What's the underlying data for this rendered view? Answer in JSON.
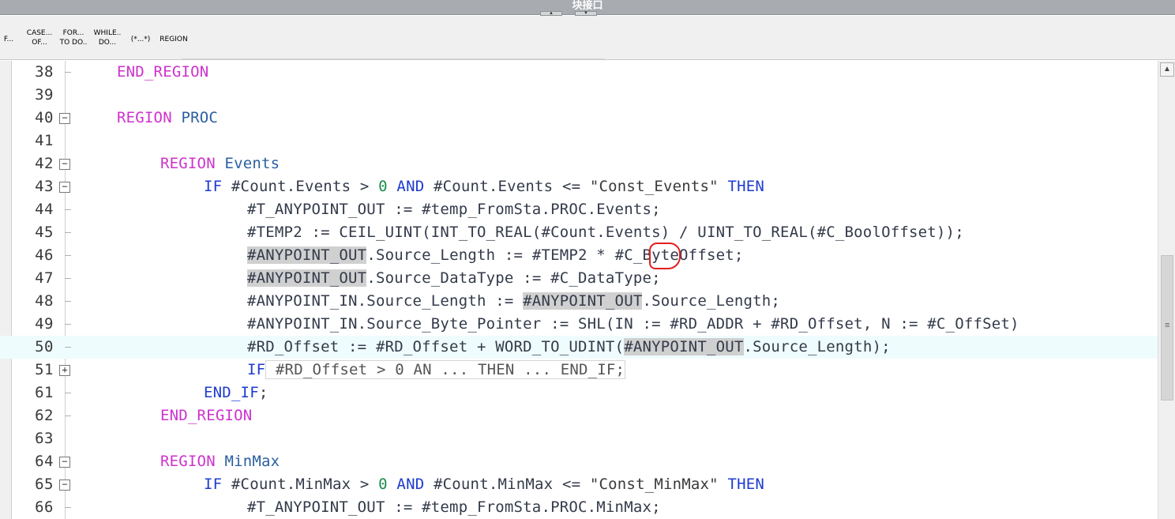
{
  "window": {
    "title": "块接口"
  },
  "toolbar": {
    "buttons": [
      {
        "line1": "F...",
        "line2": ""
      },
      {
        "line1": "CASE...",
        "line2": "OF..."
      },
      {
        "line1": "FOR...",
        "line2": "TO DO.."
      },
      {
        "line1": "WHILE..",
        "line2": "DO..."
      },
      {
        "line1": "(*...*)",
        "line2": ""
      },
      {
        "line1": "REGION",
        "line2": ""
      }
    ]
  },
  "editor": {
    "line_numbers": [
      "38",
      "39",
      "40",
      "41",
      "42",
      "43",
      "44",
      "45",
      "46",
      "47",
      "48",
      "49",
      "50",
      "51",
      "61",
      "62",
      "63",
      "64",
      "65",
      "66"
    ],
    "lines": {
      "l38": {
        "kw": "END_REGION"
      },
      "l40": {
        "kw": "REGION",
        "name": " PROC"
      },
      "l42": {
        "kw": "REGION",
        "name": " Events"
      },
      "l43": {
        "a": "IF",
        "b": " #Count.Events > ",
        "c": "0",
        "d": " AND",
        "e": " #Count.Events <= ",
        "f": "\"Const_Events\"",
        "g": " THEN"
      },
      "l44": {
        "a": "#T_ANYPOINT_OUT := #temp_FromSta.PROC.Events;"
      },
      "l45": {
        "a": "#TEMP2 := CEIL_UINT(INT_TO_REAL(#Count.Events) / UINT_TO_REAL(#C_BoolOffset));"
      },
      "l46": {
        "hl": "#ANYPOINT_OUT",
        "a": ".Source_Length := #TEMP2 * #C_ByteOffset;"
      },
      "l47": {
        "hl": "#ANYPOINT_OUT",
        "a": ".Source_DataType := #C_DataType;"
      },
      "l48": {
        "a": "#ANYPOINT_IN.Source_Length := ",
        "hl": "#ANYPOINT_OUT",
        "b": ".Source_Length;"
      },
      "l49": {
        "a": "#ANYPOINT_IN.Source_Byte_Pointer := SHL(IN := #RD_ADDR + #RD_Offset, N := #C_OffSet)"
      },
      "l50": {
        "a": "#RD_Offset := #RD_Offset + WORD_TO_UDINT(",
        "hl": "#ANYPOINT_OUT",
        "b": ".Source_Length);"
      },
      "l51": {
        "a": "IF",
        "b": " #RD_Offset > 0 AN ... THEN ... END_IF;"
      },
      "l61": {
        "kw": "END_IF",
        "a": ";"
      },
      "l62": {
        "kw": "END_REGION"
      },
      "l64": {
        "kw": "REGION",
        "name": " MinMax"
      },
      "l65": {
        "a": "IF",
        "b": " #Count.MinMax > ",
        "c": "0",
        "d": " AND",
        "e": " #Count.MinMax <= ",
        "f": "\"Const_MinMax\"",
        "g": " THEN"
      },
      "l66": {
        "a": "#T_ANYPOINT_OUT := #temp_FromSta.PROC.MinMax;"
      }
    }
  },
  "colors": {
    "keyword": "#1d3bd0",
    "region": "#cc33cc",
    "region_name": "#2b5fa0",
    "number": "#1a8c4a",
    "highlight": "#d0d0d0",
    "current_line": "#eefcfd",
    "annotation": "#e02020"
  },
  "icons": {
    "fold_open": "minus-box-icon",
    "fold_closed": "plus-box-icon",
    "scroll_up": "chevron-up-icon"
  }
}
